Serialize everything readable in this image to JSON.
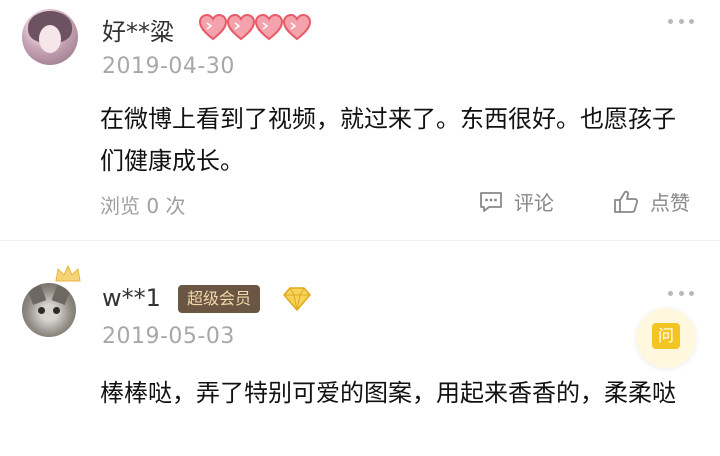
{
  "comments": [
    {
      "username": "好**粱",
      "date": "2019-04-30",
      "text": "在微博上看到了视频，就过来了。东西很好。也愿孩子们健康成长。",
      "views_label": "浏览 0 次",
      "comment_label": "评论",
      "like_label": "点赞",
      "rating_hearts": 4
    },
    {
      "username": "w**1",
      "badge": "超级会员",
      "date": "2019-05-03",
      "text": "棒棒哒，弄了特别可爱的图案，用起来香香的，柔柔哒",
      "ask_label": "问"
    }
  ],
  "colors": {
    "heart": "#e85a6a",
    "badge_bg": "#6b5643",
    "badge_text": "#f2d7a7",
    "ask_yellow": "#f4c522",
    "date_gray": "#a8a8a8"
  }
}
